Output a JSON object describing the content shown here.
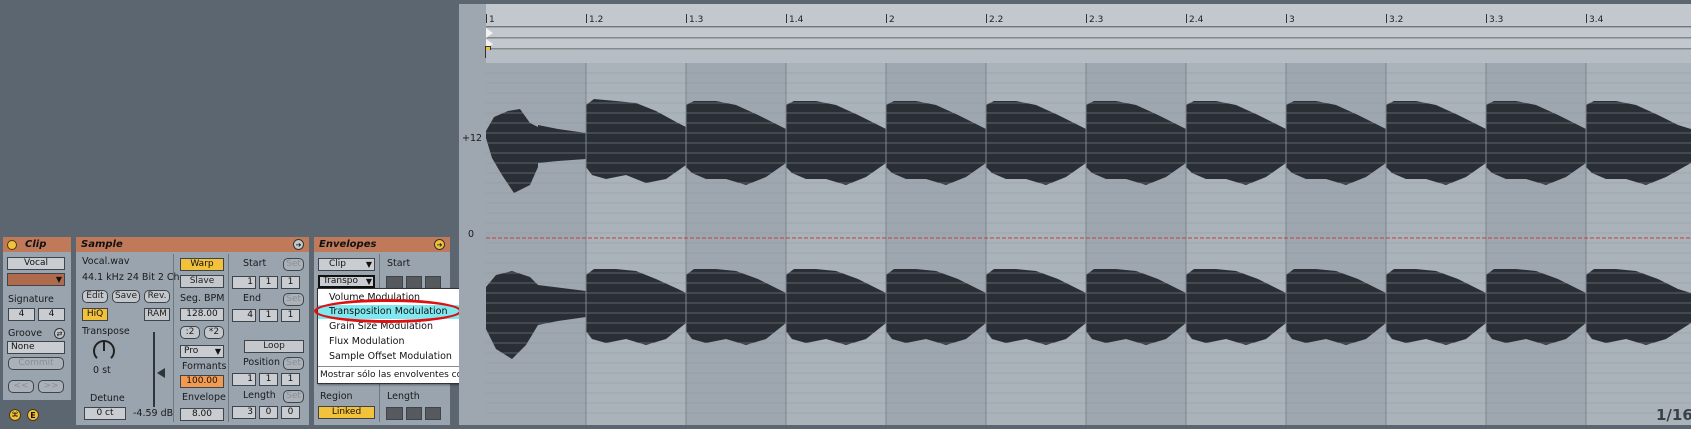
{
  "clip_panel": {
    "title": "Clip",
    "name": "Vocal",
    "signature_label": "Signature",
    "signature_num": "4",
    "signature_den": "4",
    "groove_label": "Groove",
    "groove_value": "None",
    "commit_label": "Commit",
    "prev_label": "<<",
    "next_label": ">>",
    "color": "#b06a4c"
  },
  "sample_panel": {
    "title": "Sample",
    "file_name": "Vocal.wav",
    "file_info": "44.1 kHz 24 Bit 2 Ch",
    "edit_label": "Edit",
    "save_label": "Save",
    "rev_label": "Rev.",
    "hiq_label": "HiQ",
    "ram_label": "RAM",
    "transpose_label": "Transpose",
    "transpose_value": "0 st",
    "detune_label": "Detune",
    "detune_value": "0 ct",
    "volume_value": "-4.59 dB",
    "warp_label": "Warp",
    "slave_label": "Slave",
    "seg_bpm_label": "Seg. BPM",
    "seg_bpm_value": "128.00",
    "half_label": ":2",
    "double_label": "*2",
    "warp_mode": "Pro",
    "formants_label": "Formants",
    "formants_value": "100.00",
    "envelope_label": "Envelope",
    "envelope_value": "8.00",
    "start_label": "Start",
    "start_values": [
      "1",
      "1",
      "1"
    ],
    "end_label": "End",
    "end_values": [
      "4",
      "1",
      "1"
    ],
    "set_label": "Set",
    "loop_label": "Loop",
    "position_label": "Position",
    "position_values": [
      "1",
      "1",
      "1"
    ],
    "length_label": "Length",
    "length_values": [
      "3",
      "0",
      "0"
    ]
  },
  "envelopes_panel": {
    "title": "Envelopes",
    "device_select": "Clip",
    "control_select": "Transpo",
    "start_label": "Start",
    "region_label": "Region",
    "linked_label": "Linked",
    "length_label": "Length"
  },
  "dropdown": {
    "items": [
      "Volume Modulation",
      "Transposition Modulation",
      "Grain Size Modulation",
      "Flux Modulation",
      "Sample Offset Modulation"
    ],
    "selected_index": 1,
    "footer": "Mostrar sólo las envolventes con ajustes",
    "highlight_color": "#7fe9ef",
    "annotation_color": "#e01010"
  },
  "timeline": {
    "ruler_labels": [
      "1",
      "1.2",
      "1.3",
      "1.4",
      "2",
      "2.2",
      "2.3",
      "2.4",
      "3",
      "3.2",
      "3.3",
      "3.4"
    ],
    "y_labels": [
      "+12",
      "0"
    ],
    "zoom_label": "1/16",
    "center_line_color": "#c83c3c",
    "waveform_color": "#2a2f36"
  },
  "footer_icons": [
    "hot-swap-icon",
    "e-icon"
  ]
}
